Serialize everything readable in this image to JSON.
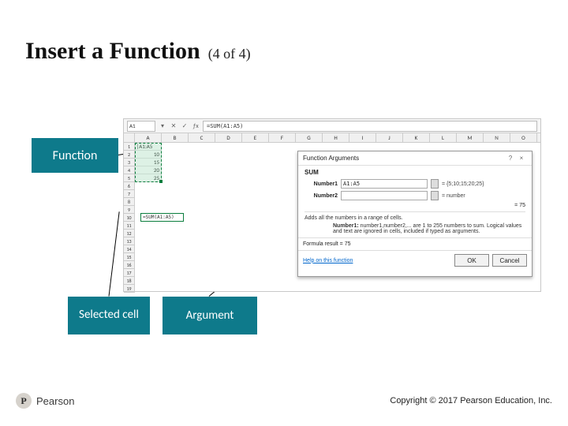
{
  "title": {
    "main": "Insert a Function",
    "sub": "(4 of 4)"
  },
  "callouts": {
    "function": "Function",
    "selected_cell": "Selected cell",
    "argument": "Argument"
  },
  "screenshot": {
    "name_box": "A1",
    "formula_bar": "=SUM(A1:A5)",
    "columns": [
      "A",
      "B",
      "C",
      "D",
      "E",
      "F",
      "G",
      "H",
      "I",
      "J",
      "K",
      "L",
      "M",
      "N",
      "O"
    ],
    "rows": [
      "1",
      "2",
      "3",
      "4",
      "5",
      "6",
      "7",
      "8",
      "9",
      "10",
      "11",
      "12",
      "13",
      "14",
      "15",
      "16",
      "17",
      "18",
      "19"
    ],
    "data_colA": {
      "r1": "|A1:A5",
      "r2": "10",
      "r3": "15",
      "r4": "20",
      "r5": "25"
    },
    "selected_cell_marker": "=SUM(A1:A5)"
  },
  "dialog": {
    "title": "Function Arguments",
    "function_name": "SUM",
    "arg1_label": "Number1",
    "arg1_value": "A1:A5",
    "arg1_eval": "= {5;10;15;20;25}",
    "arg2_label": "Number2",
    "arg2_eval": "= number",
    "desc": "Adds all the numbers in a range of cells.",
    "arg_help_bold": "Number1:",
    "arg_help_rest": " number1,number2,... are 1 to 255 numbers to sum. Logical values and text are ignored in cells, included if typed as arguments.",
    "result_right": "= 75",
    "result_label": "Formula result = 75",
    "help_link": "Help on this function",
    "ok": "OK",
    "cancel": "Cancel"
  },
  "branding": {
    "p": "P",
    "name": "Pearson"
  },
  "copyright": "Copyright © 2017 Pearson Education, Inc."
}
